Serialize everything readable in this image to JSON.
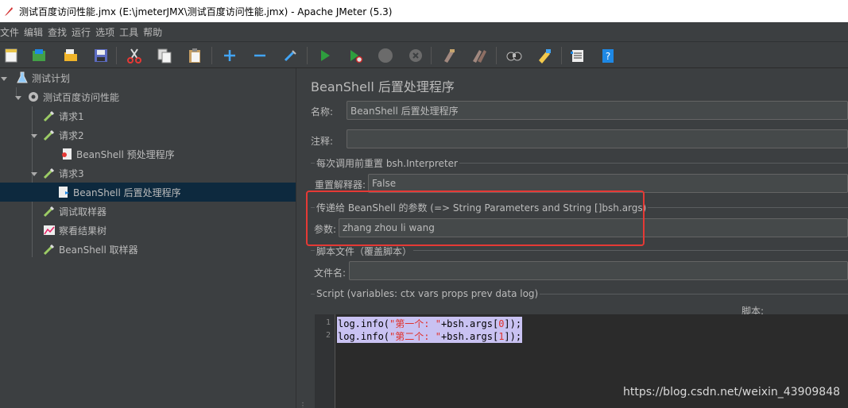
{
  "window": {
    "title": "测试百度访问性能.jmx (E:\\jmeterJMX\\测试百度访问性能.jmx) - Apache JMeter (5.3)"
  },
  "menu": [
    "文件",
    "编辑",
    "查找",
    "运行",
    "选项",
    "工具",
    "帮助"
  ],
  "toolbar": {
    "icons": [
      "new-icon",
      "templates-icon",
      "open-icon",
      "save-icon",
      "cut-icon",
      "copy-icon",
      "paste-icon",
      "expand-icon",
      "collapse-icon",
      "toggle-icon",
      "start-icon",
      "start-no-pause-icon",
      "stop-icon",
      "shutdown-icon",
      "clear-icon",
      "clear-all-icon",
      "search-icon",
      "reset-search-icon",
      "function-helper-icon",
      "help-icon"
    ]
  },
  "tree": {
    "items": [
      {
        "label": "测试计划",
        "icon": "test-plan-icon"
      },
      {
        "label": "测试百度访问性能",
        "icon": "thread-group-icon"
      },
      {
        "label": "请求1",
        "icon": "sampler-icon"
      },
      {
        "label": "请求2",
        "icon": "sampler-icon"
      },
      {
        "label": "BeanShell 预处理程序",
        "icon": "preprocessor-icon"
      },
      {
        "label": "请求3",
        "icon": "sampler-icon"
      },
      {
        "label": "BeanShell 后置处理程序",
        "icon": "postprocessor-icon"
      },
      {
        "label": "调试取样器",
        "icon": "sampler-icon"
      },
      {
        "label": "察看结果树",
        "icon": "listener-icon"
      },
      {
        "label": "BeanShell 取样器",
        "icon": "sampler-icon"
      }
    ],
    "selected_index": 6
  },
  "panel": {
    "title": "BeanShell 后置处理程序",
    "name_label": "名称:",
    "name_value": "BeanShell 后置处理程序",
    "comment_label": "注释:",
    "comment_value": "",
    "reset_group_title": "每次调用前重置 bsh.Interpreter",
    "reset_label": "重置解释器:",
    "reset_value": "False",
    "params_group_title": "传递给 BeanShell 的参数 (=> String Parameters and String []bsh.args)",
    "params_label": "参数:",
    "params_value": "zhang zhou li wang",
    "file_group_title": "脚本文件（覆盖脚本）",
    "file_label": "文件名:",
    "file_value": "",
    "script_group_title": "Script (variables: ctx vars props prev data log)",
    "script_label": "脚本:",
    "code": [
      {
        "line_no": "1",
        "pre": "log.info(",
        "str": "\"第一个: \"",
        "mid": "+bsh.args[",
        "num": "0",
        "post": "]);"
      },
      {
        "line_no": "2",
        "pre": "log.info(",
        "str": "\"第二个: \"",
        "mid": "+bsh.args[",
        "num": "1",
        "post": "]);"
      }
    ]
  },
  "watermark": "https://blog.csdn.net/weixin_43909848",
  "colors": {
    "highlight_box": "#e53935",
    "selection": "#0d293e",
    "code_selection": "#c9c2f2"
  }
}
